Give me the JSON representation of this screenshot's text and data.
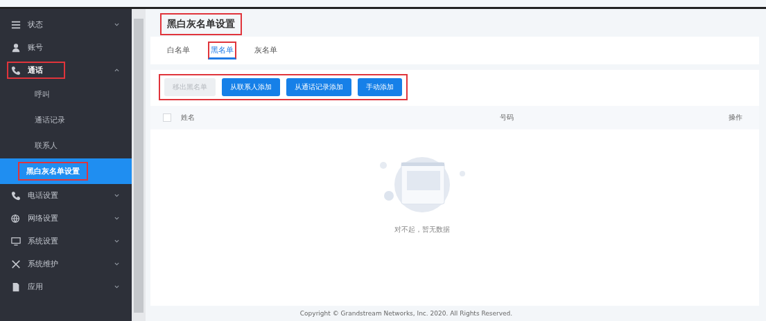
{
  "sidebar": {
    "items": [
      {
        "label": "状态",
        "expanded": false,
        "highlighted": false
      },
      {
        "label": "账号",
        "highlighted": false
      },
      {
        "label": "通话",
        "expanded": true,
        "highlighted": true,
        "children": [
          {
            "label": "呼叫",
            "selected": false,
            "highlighted": false
          },
          {
            "label": "通话记录",
            "selected": false,
            "highlighted": false
          },
          {
            "label": "联系人",
            "selected": false,
            "highlighted": false
          },
          {
            "label": "黑白灰名单设置",
            "selected": true,
            "highlighted": true
          }
        ]
      },
      {
        "label": "电话设置",
        "expanded": false,
        "highlighted": false
      },
      {
        "label": "网络设置",
        "expanded": false,
        "highlighted": false
      },
      {
        "label": "系统设置",
        "expanded": false,
        "highlighted": false
      },
      {
        "label": "系统维护",
        "expanded": false,
        "highlighted": false
      },
      {
        "label": "应用",
        "expanded": false,
        "highlighted": false
      }
    ]
  },
  "page_title": {
    "text": "黑白灰名单设置",
    "highlighted": true
  },
  "tabs": [
    {
      "label": "白名单",
      "selected": false,
      "highlighted": false
    },
    {
      "label": "黑名单",
      "selected": true,
      "highlighted": true
    },
    {
      "label": "灰名单",
      "selected": false,
      "highlighted": false
    }
  ],
  "toolbar": {
    "highlighted": true,
    "buttons": [
      {
        "label": "移出黑名单",
        "disabled": true
      },
      {
        "label": "从联系人添加",
        "disabled": false
      },
      {
        "label": "从通话记录添加",
        "disabled": false
      },
      {
        "label": "手动添加",
        "disabled": false
      }
    ]
  },
  "table": {
    "select_all_checked": false,
    "columns": [
      "姓名",
      "号码",
      "操作"
    ],
    "empty_text": "对不起，暂无数据"
  },
  "footer": "Copyright © Grandstream Networks, Inc. 2020. All Rights Reserved."
}
